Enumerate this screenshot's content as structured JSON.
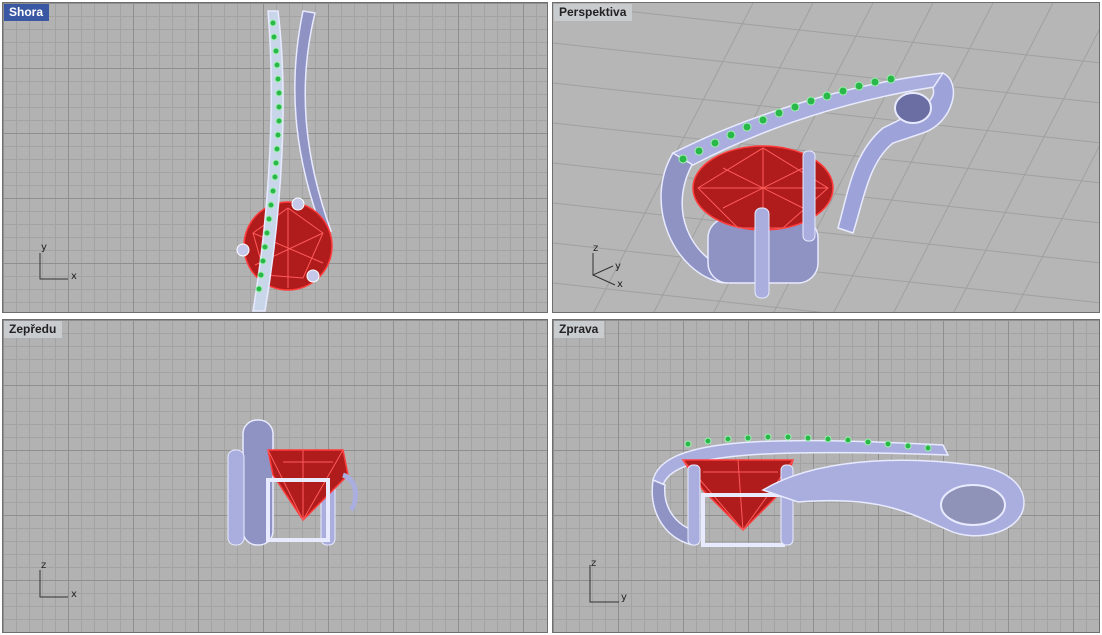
{
  "viewports": {
    "top": {
      "label": "Shora",
      "axis_v": "y",
      "axis_h": "x"
    },
    "perspective": {
      "label": "Perspektiva",
      "axis_v": "z",
      "axis_h": "x",
      "axis_d": "y"
    },
    "front": {
      "label": "Zepředu",
      "axis_v": "z",
      "axis_h": "x"
    },
    "right": {
      "label": "Zprava",
      "axis_v": "z",
      "axis_h": "y"
    }
  },
  "colors": {
    "metal": "#a9aedf",
    "metal_edge": "#e8eaff",
    "gem": "#b01c1c",
    "gem_edge": "#ff3b3b",
    "stones": "#5ee07a",
    "active_label": "#3a57a3",
    "inactive_label": "#c9cccf"
  }
}
